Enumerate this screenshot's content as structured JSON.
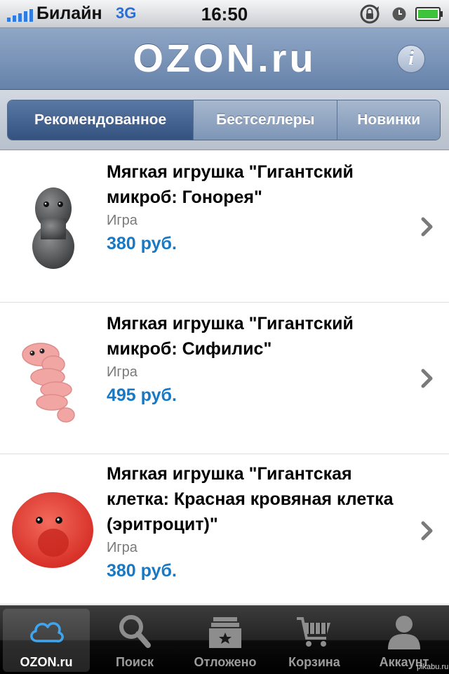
{
  "status_bar": {
    "carrier": "Билайн",
    "network": "3G",
    "time": "16:50",
    "signal_bars": 5,
    "accent_color": "#2f7be0"
  },
  "header": {
    "logo": "OZON.ru",
    "info_label": "i",
    "color": "#7891b5"
  },
  "segments": [
    {
      "label": "Рекомендованное",
      "active": true
    },
    {
      "label": "Бестселлеры",
      "active": false
    },
    {
      "label": "Новинки",
      "active": false
    }
  ],
  "products": [
    {
      "title": "Мягкая игрушка \"Гигантский микроб: Гонорея\"",
      "category": "Игра",
      "price": "380 руб.",
      "image_icon": "gray-microbe-toy"
    },
    {
      "title": "Мягкая игрушка \"Гигантский микроб: Сифилис\"",
      "category": "Игра",
      "price": "495 руб.",
      "image_icon": "pink-spiral-microbe-toy"
    },
    {
      "title": "Мягкая игрушка \"Гигантская клетка: Красная кровяная клетка (эритроцит)\"",
      "category": "Игра",
      "price": "380 руб.",
      "image_icon": "red-blood-cell-toy"
    }
  ],
  "price_color": "#1779c5",
  "tab_bar": {
    "tabs": [
      {
        "label": "OZON.ru",
        "icon": "cloud-icon",
        "active": true
      },
      {
        "label": "Поиск",
        "icon": "search-icon",
        "active": false
      },
      {
        "label": "Отложено",
        "icon": "archive-box-icon",
        "active": false
      },
      {
        "label": "Корзина",
        "icon": "cart-icon",
        "active": false
      },
      {
        "label": "Аккаунт",
        "icon": "person-icon",
        "active": false
      }
    ]
  },
  "watermark": "pikabu.ru"
}
